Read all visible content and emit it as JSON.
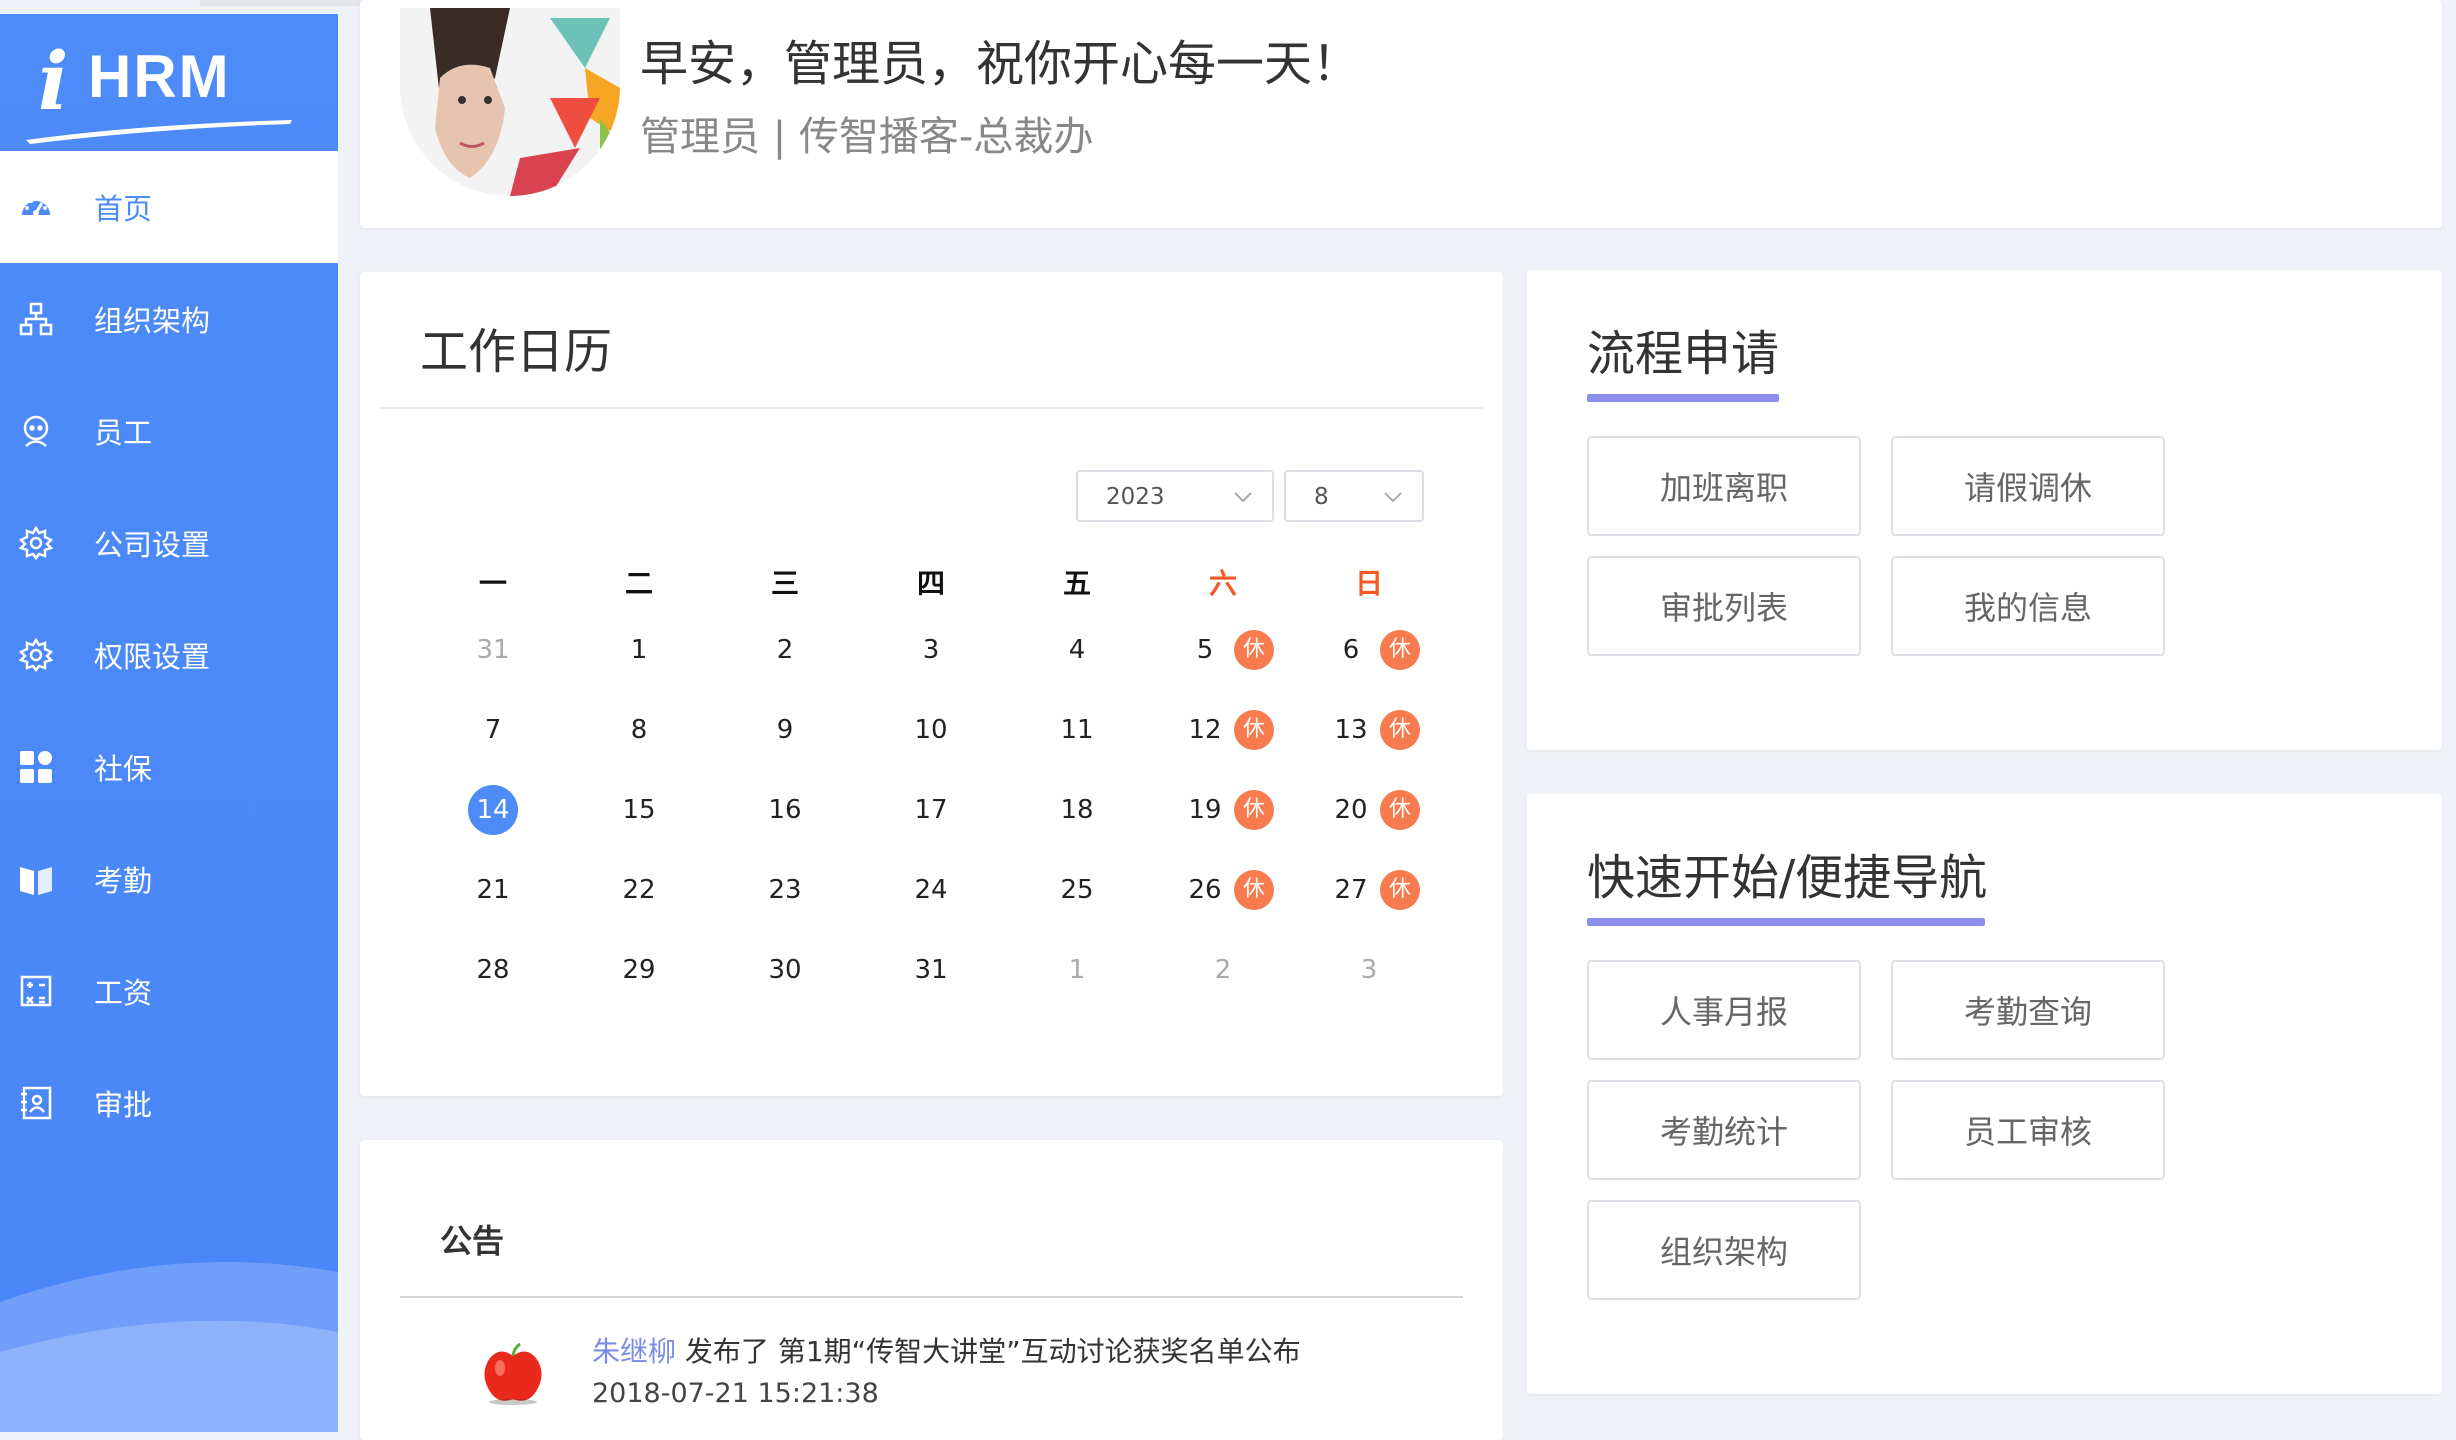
{
  "app": {
    "logo_i": "i",
    "logo_hrm": "HRM"
  },
  "sidebar": {
    "items": [
      {
        "label": "首页",
        "icon": "dashboard-icon",
        "active": true
      },
      {
        "label": "组织架构",
        "icon": "org-chart-icon"
      },
      {
        "label": "员工",
        "icon": "employee-icon"
      },
      {
        "label": "公司设置",
        "icon": "gear-icon"
      },
      {
        "label": "权限设置",
        "icon": "gear-icon"
      },
      {
        "label": "社保",
        "icon": "grid-icon"
      },
      {
        "label": "考勤",
        "icon": "book-icon"
      },
      {
        "label": "工资",
        "icon": "calculator-icon"
      },
      {
        "label": "审批",
        "icon": "approval-icon"
      }
    ]
  },
  "greeting": {
    "title": "早安，管理员，祝你开心每一天！",
    "subtitle": "管理员 | 传智播客-总裁办"
  },
  "calendar": {
    "title": "工作日历",
    "year": "2023",
    "month": "8",
    "weekdays": [
      "一",
      "二",
      "三",
      "四",
      "五",
      "六",
      "日"
    ],
    "rest_label": "休",
    "weeks": [
      [
        "31",
        "1",
        "2",
        "3",
        "4",
        "5",
        "6"
      ],
      [
        "7",
        "8",
        "9",
        "10",
        "11",
        "12",
        "13"
      ],
      [
        "14",
        "15",
        "16",
        "17",
        "18",
        "19",
        "20"
      ],
      [
        "21",
        "22",
        "23",
        "24",
        "25",
        "26",
        "27"
      ],
      [
        "28",
        "29",
        "30",
        "31",
        "1",
        "2",
        "3"
      ]
    ],
    "today": "14"
  },
  "notice": {
    "title": "公告",
    "author": "朱继柳",
    "text": " 发布了 第1期“传智大讲堂”互动讨论获奖名单公布",
    "time": "2018-07-21 15:21:38"
  },
  "process": {
    "title": "流程申请",
    "buttons": [
      "加班离职",
      "请假调休",
      "审批列表",
      "我的信息"
    ]
  },
  "quicknav": {
    "title": "快速开始/便捷导航",
    "buttons": [
      "人事月报",
      "考勤查询",
      "考勤统计",
      "员工审核",
      "组织架构"
    ]
  },
  "colors": {
    "sidebar_bg": "#4d8bf8",
    "accent": "#4d8bf8",
    "weekend": "#f05a24",
    "rest_badge": "#f77b4f",
    "underline": "#8c8fec"
  }
}
